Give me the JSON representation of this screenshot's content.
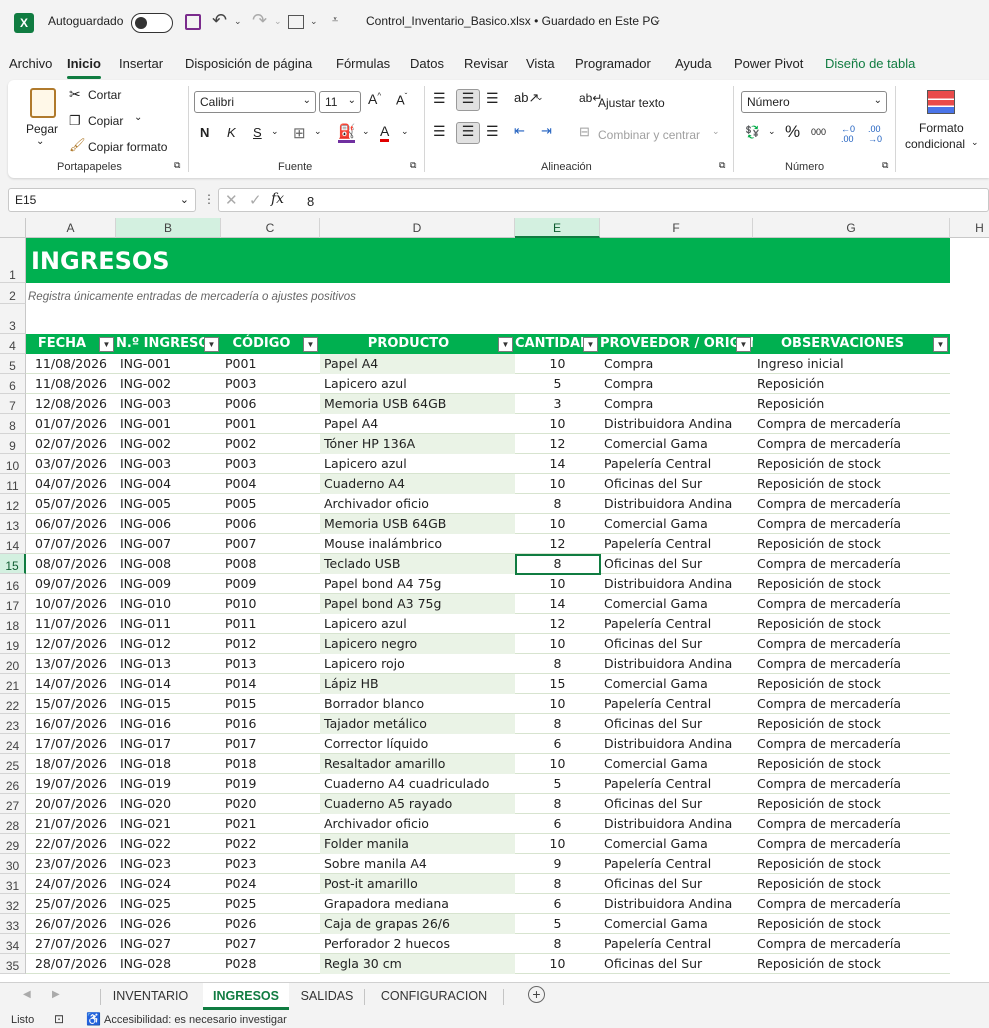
{
  "titlebar": {
    "autosave_label": "Autoguardado",
    "file_title": "Control_Inventario_Basico.xlsx • Guardado en Este PC"
  },
  "menu": [
    "Archivo",
    "Inicio",
    "Insertar",
    "Disposición de página",
    "Fórmulas",
    "Datos",
    "Revisar",
    "Vista",
    "Programador",
    "Ayuda",
    "Power Pivot",
    "Diseño de tabla"
  ],
  "ribbon": {
    "paste": "Pegar",
    "cut": "Cortar",
    "copy": "Copiar",
    "copy_format": "Copiar formato",
    "clipboard_label": "Portapapeles",
    "font_name": "Calibri",
    "font_size": "11",
    "font_label": "Fuente",
    "wrap_text": "Ajustar texto",
    "merge_center": "Combinar y centrar",
    "alignment_label": "Alineación",
    "number_format": "Número",
    "number_label": "Número",
    "cond_format_1": "Formato",
    "cond_format_2": "condicional"
  },
  "formula_bar": {
    "cell_ref": "E15",
    "value": "8"
  },
  "columns": [
    "A",
    "B",
    "C",
    "D",
    "E",
    "F",
    "G",
    "H"
  ],
  "sheet": {
    "title": "INGRESOS",
    "subtitle": "Registra únicamente entradas de mercadería o ajustes positivos",
    "headers": [
      "FECHA",
      "N.º INGRESO",
      "CÓDIGO",
      "PRODUCTO",
      "CANTIDAD",
      "PROVEEDOR / ORIGEN",
      "OBSERVACIONES"
    ],
    "rows": [
      [
        "11/08/2026",
        "ING-001",
        "P001",
        "Papel A4",
        "10",
        "Compra",
        "Ingreso inicial"
      ],
      [
        "11/08/2026",
        "ING-002",
        "P003",
        "Lapicero azul",
        "5",
        "Compra",
        "Reposición"
      ],
      [
        "12/08/2026",
        "ING-003",
        "P006",
        "Memoria USB 64GB",
        "3",
        "Compra",
        "Reposición"
      ],
      [
        "01/07/2026",
        "ING-001",
        "P001",
        "Papel A4",
        "10",
        "Distribuidora Andina",
        "Compra de mercadería"
      ],
      [
        "02/07/2026",
        "ING-002",
        "P002",
        "Tóner HP 136A",
        "12",
        "Comercial Gama",
        "Compra de mercadería"
      ],
      [
        "03/07/2026",
        "ING-003",
        "P003",
        "Lapicero azul",
        "14",
        "Papelería Central",
        "Reposición de stock"
      ],
      [
        "04/07/2026",
        "ING-004",
        "P004",
        "Cuaderno A4",
        "10",
        "Oficinas del Sur",
        "Reposición de stock"
      ],
      [
        "05/07/2026",
        "ING-005",
        "P005",
        "Archivador oficio",
        "8",
        "Distribuidora Andina",
        "Compra de mercadería"
      ],
      [
        "06/07/2026",
        "ING-006",
        "P006",
        "Memoria USB 64GB",
        "10",
        "Comercial Gama",
        "Compra de mercadería"
      ],
      [
        "07/07/2026",
        "ING-007",
        "P007",
        "Mouse inalámbrico",
        "12",
        "Papelería Central",
        "Reposición de stock"
      ],
      [
        "08/07/2026",
        "ING-008",
        "P008",
        "Teclado USB",
        "8",
        "Oficinas del Sur",
        "Compra de mercadería"
      ],
      [
        "09/07/2026",
        "ING-009",
        "P009",
        "Papel bond A4 75g",
        "10",
        "Distribuidora Andina",
        "Reposición de stock"
      ],
      [
        "10/07/2026",
        "ING-010",
        "P010",
        "Papel bond A3 75g",
        "14",
        "Comercial Gama",
        "Compra de mercadería"
      ],
      [
        "11/07/2026",
        "ING-011",
        "P011",
        "Lapicero azul",
        "12",
        "Papelería Central",
        "Reposición de stock"
      ],
      [
        "12/07/2026",
        "ING-012",
        "P012",
        "Lapicero negro",
        "10",
        "Oficinas del Sur",
        "Compra de mercadería"
      ],
      [
        "13/07/2026",
        "ING-013",
        "P013",
        "Lapicero rojo",
        "8",
        "Distribuidora Andina",
        "Compra de mercadería"
      ],
      [
        "14/07/2026",
        "ING-014",
        "P014",
        "Lápiz HB",
        "15",
        "Comercial Gama",
        "Reposición de stock"
      ],
      [
        "15/07/2026",
        "ING-015",
        "P015",
        "Borrador blanco",
        "10",
        "Papelería Central",
        "Compra de mercadería"
      ],
      [
        "16/07/2026",
        "ING-016",
        "P016",
        "Tajador metálico",
        "8",
        "Oficinas del Sur",
        "Reposición de stock"
      ],
      [
        "17/07/2026",
        "ING-017",
        "P017",
        "Corrector líquido",
        "6",
        "Distribuidora Andina",
        "Compra de mercadería"
      ],
      [
        "18/07/2026",
        "ING-018",
        "P018",
        "Resaltador amarillo",
        "10",
        "Comercial Gama",
        "Reposición de stock"
      ],
      [
        "19/07/2026",
        "ING-019",
        "P019",
        "Cuaderno A4 cuadriculado",
        "5",
        "Papelería Central",
        "Compra de mercadería"
      ],
      [
        "20/07/2026",
        "ING-020",
        "P020",
        "Cuaderno A5 rayado",
        "8",
        "Oficinas del Sur",
        "Reposición de stock"
      ],
      [
        "21/07/2026",
        "ING-021",
        "P021",
        "Archivador oficio",
        "6",
        "Distribuidora Andina",
        "Compra de mercadería"
      ],
      [
        "22/07/2026",
        "ING-022",
        "P022",
        "Folder manila",
        "10",
        "Comercial Gama",
        "Compra de mercadería"
      ],
      [
        "23/07/2026",
        "ING-023",
        "P023",
        "Sobre manila A4",
        "9",
        "Papelería Central",
        "Reposición de stock"
      ],
      [
        "24/07/2026",
        "ING-024",
        "P024",
        "Post-it amarillo",
        "8",
        "Oficinas del Sur",
        "Reposición de stock"
      ],
      [
        "25/07/2026",
        "ING-025",
        "P025",
        "Grapadora mediana",
        "6",
        "Distribuidora Andina",
        "Compra de mercadería"
      ],
      [
        "26/07/2026",
        "ING-026",
        "P026",
        "Caja de grapas 26/6",
        "5",
        "Comercial Gama",
        "Reposición de stock"
      ],
      [
        "27/07/2026",
        "ING-027",
        "P027",
        "Perforador 2 huecos",
        "8",
        "Papelería Central",
        "Compra de mercadería"
      ],
      [
        "28/07/2026",
        "ING-028",
        "P028",
        "Regla 30 cm",
        "10",
        "Oficinas del Sur",
        "Reposición de stock"
      ]
    ]
  },
  "tabs": [
    "INVENTARIO",
    "INGRESOS",
    "SALIDAS",
    "CONFIGURACION"
  ],
  "status": {
    "ready": "Listo",
    "accessibility": "Accesibilidad: es necesario investigar"
  },
  "colors": {
    "excel_green": "#107c41",
    "header_green": "#00b050",
    "band": "#eaf3e6"
  }
}
